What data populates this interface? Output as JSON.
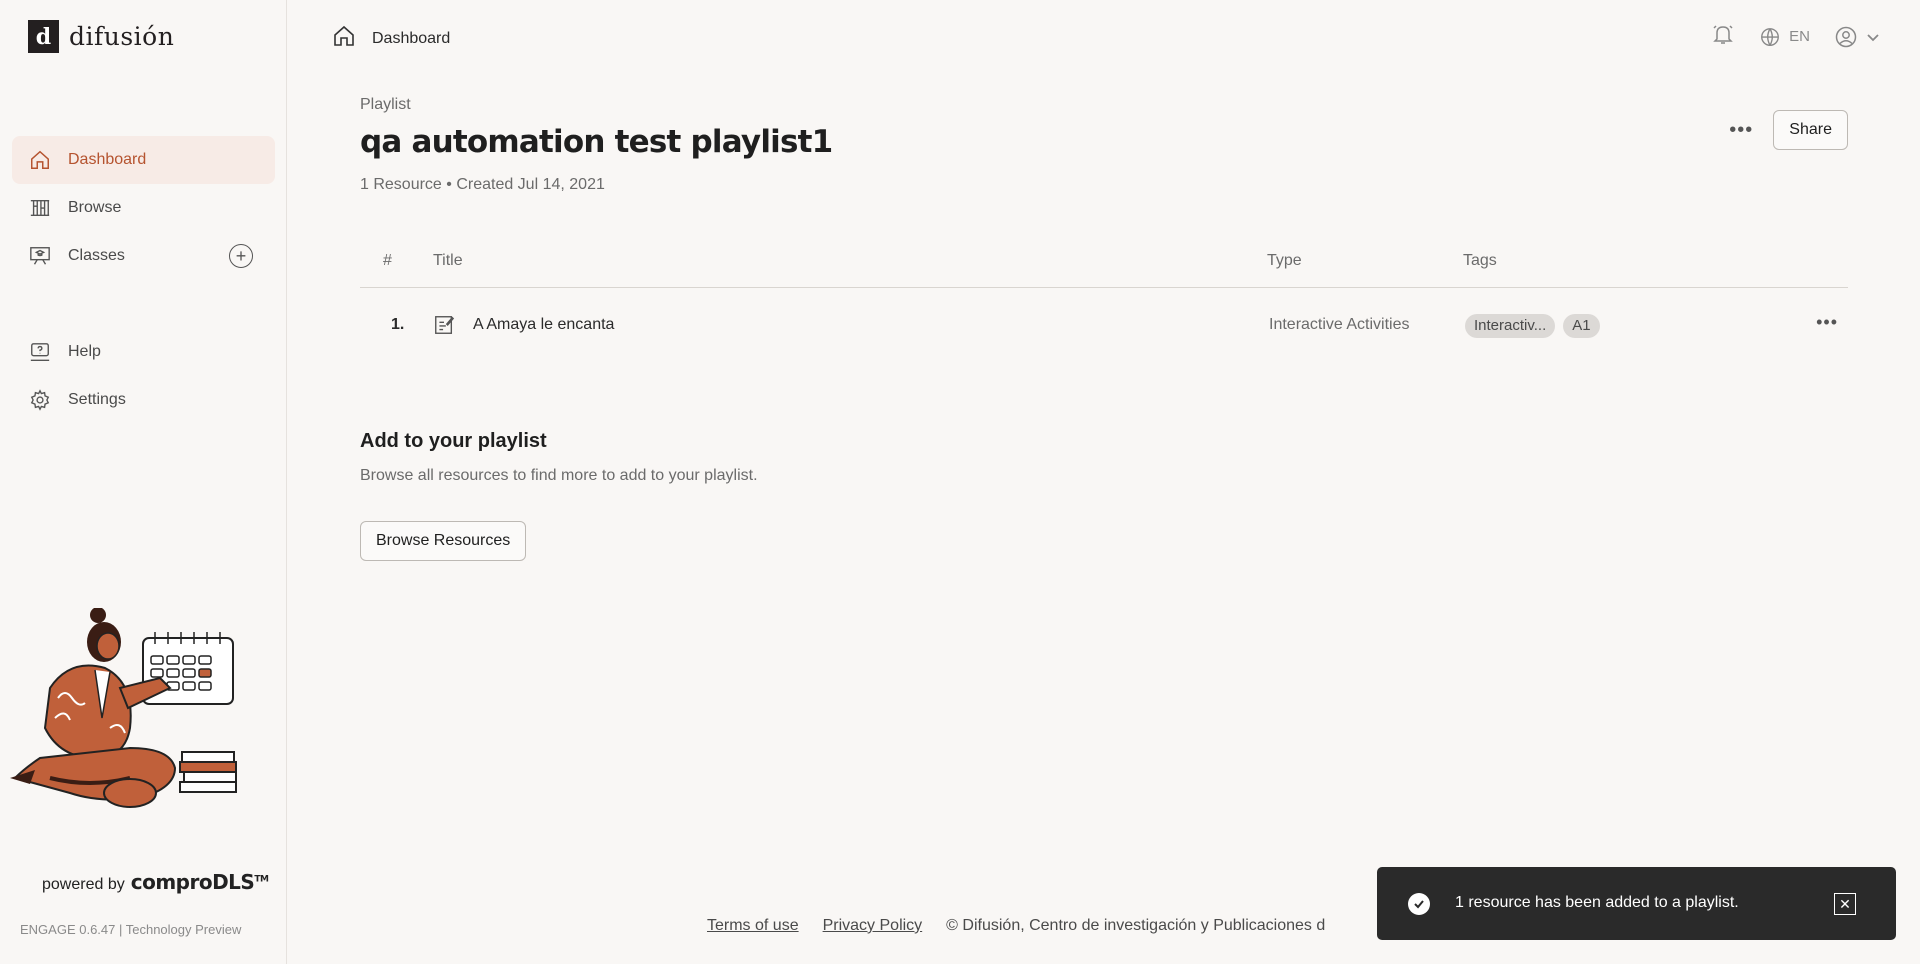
{
  "brand": {
    "logo_text": "difusión",
    "logo_mark": "d"
  },
  "sidebar": {
    "items": [
      {
        "label": "Dashboard",
        "icon": "home-icon",
        "active": true
      },
      {
        "label": "Browse",
        "icon": "library-icon"
      },
      {
        "label": "Classes",
        "icon": "classroom-icon"
      },
      {
        "label": "Help",
        "icon": "help-icon"
      },
      {
        "label": "Settings",
        "icon": "gear-icon"
      }
    ],
    "powered_by": "powered by",
    "powered_brand": "comproDLS",
    "trademark": "TM",
    "version": "ENGAGE 0.6.47 | Technology Preview"
  },
  "header": {
    "breadcrumb": "Dashboard",
    "language": "EN"
  },
  "playlist": {
    "eyebrow": "Playlist",
    "title": "qa automation test playlist1",
    "meta": "1 Resource • Created Jul 14, 2021",
    "more_label": "•••",
    "share_label": "Share"
  },
  "table": {
    "headers": {
      "num": "#",
      "title": "Title",
      "type": "Type",
      "tags": "Tags"
    },
    "rows": [
      {
        "num": "1.",
        "title": "A Amaya le encanta",
        "type": "Interactive Activities",
        "tags": [
          "Interactiv...",
          "A1"
        ],
        "more": "•••"
      }
    ]
  },
  "add_section": {
    "title": "Add to your playlist",
    "description": "Browse all resources to find more to add to your playlist.",
    "button": "Browse Resources"
  },
  "footer": {
    "terms": "Terms of use",
    "privacy": "Privacy Policy",
    "copyright": "© Difusión, Centro de investigación y Publicaciones d"
  },
  "toast": {
    "message": "1 resource has been added to a playlist.",
    "close": "✕"
  },
  "colors": {
    "accent": "#b5532f",
    "active_bg": "#f7ebe6",
    "background": "#f9f7f5",
    "toast_bg": "#2a2a2a"
  }
}
